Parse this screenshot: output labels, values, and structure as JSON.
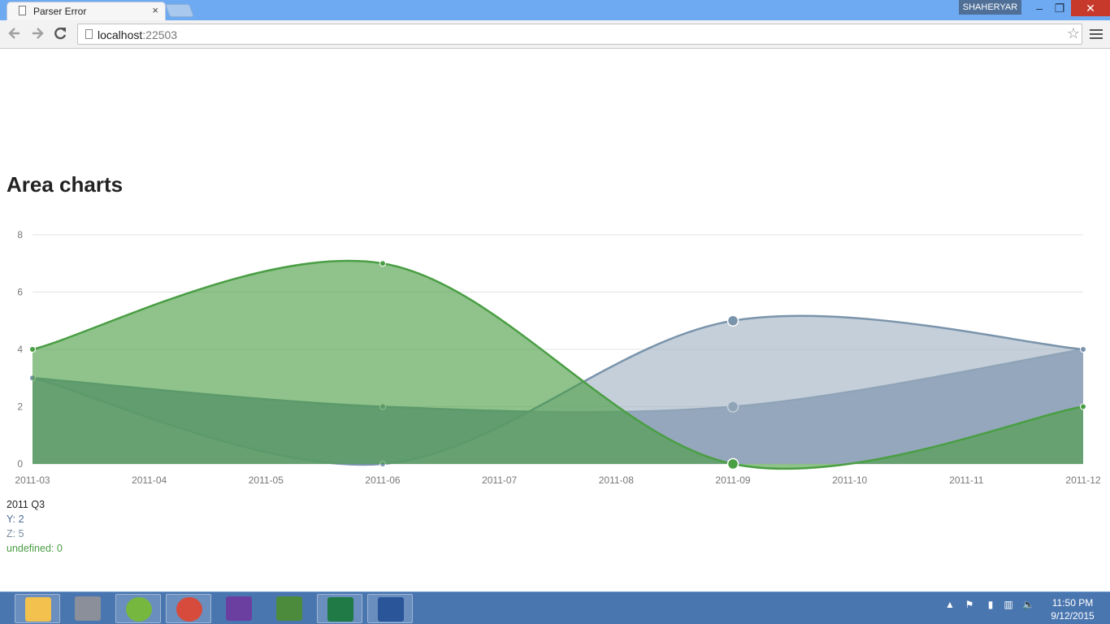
{
  "browser": {
    "tab_title": "Parser Error",
    "tab_close": "×",
    "url_host": "localhost",
    "url_port": ":22503",
    "user": "SHAHERYAR",
    "win_min": "–",
    "win_restore": "❐",
    "win_close": "✕"
  },
  "page": {
    "title": "Area charts"
  },
  "colors": {
    "series_green": "#4a9e44",
    "series_blue": "#7a94ab",
    "grid": "#e3e3e3"
  },
  "chart_data": {
    "type": "area",
    "x": [
      "2011-03",
      "2011-06",
      "2011-09",
      "2011-12"
    ],
    "xticks": [
      "2011-03",
      "2011-04",
      "2011-05",
      "2011-06",
      "2011-07",
      "2011-08",
      "2011-09",
      "2011-10",
      "2011-11",
      "2011-12"
    ],
    "yticks": [
      "0",
      "2",
      "4",
      "6",
      "8"
    ],
    "ylim": [
      0,
      8
    ],
    "grid": true,
    "series": [
      {
        "name": "Y",
        "values": [
          3,
          2,
          2,
          4
        ],
        "color": "#6d86a2"
      },
      {
        "name": "Z",
        "values": [
          3,
          0,
          5,
          4
        ],
        "color": "#9fafc1"
      },
      {
        "name": "undefined",
        "values": [
          4,
          7,
          0,
          2
        ],
        "color": "#4a9e44"
      }
    ]
  },
  "hover": {
    "title": "2011 Q3",
    "y": "Y: 2",
    "z": "Z: 5",
    "u": "undefined: 0"
  },
  "taskbar": {
    "apps": [
      "file-explorer-icon",
      "firewall-icon",
      "utorrent-icon",
      "chrome-icon",
      "visual-studio-icon",
      "notepad-plus-icon",
      "excel-icon",
      "word-icon"
    ],
    "time": "11:50 PM",
    "date": "9/12/2015"
  }
}
